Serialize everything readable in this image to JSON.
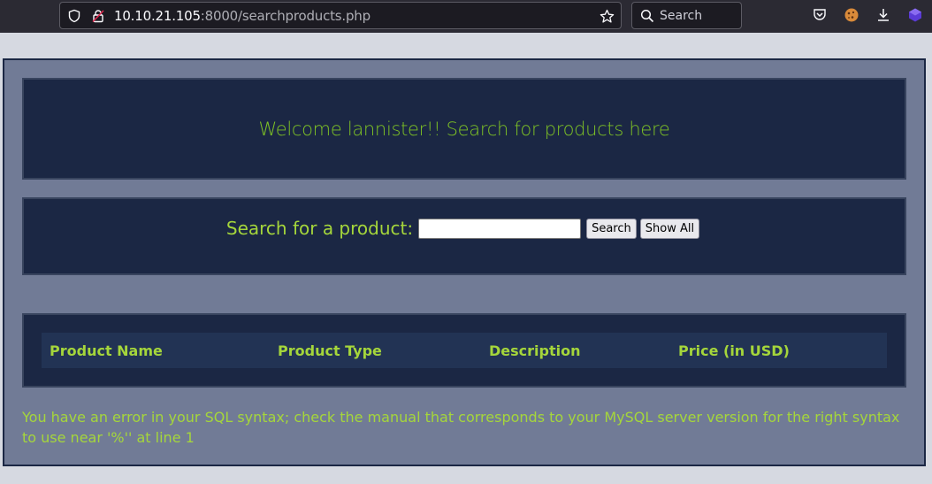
{
  "browser": {
    "url_host": "10.10.21.105",
    "url_rest": ":8000/searchproducts.php",
    "search_placeholder": "Search"
  },
  "welcome": {
    "text": "Welcome lannister!! Search for products here"
  },
  "search_form": {
    "label": "Search for a product:",
    "input_value": "",
    "search_button": "Search",
    "show_all_button": "Show All"
  },
  "results_table": {
    "columns": [
      "Product Name",
      "Product Type",
      "Description",
      "Price (in USD)"
    ],
    "rows": []
  },
  "error": {
    "text": "You have an error in your SQL syntax; check the manual that corresponds to your MySQL server version for the right syntax to use near '%'' at line 1"
  },
  "colors": {
    "accent_green": "#a5d63b",
    "panel_bg": "#1b2744",
    "page_bg": "#717b96"
  }
}
